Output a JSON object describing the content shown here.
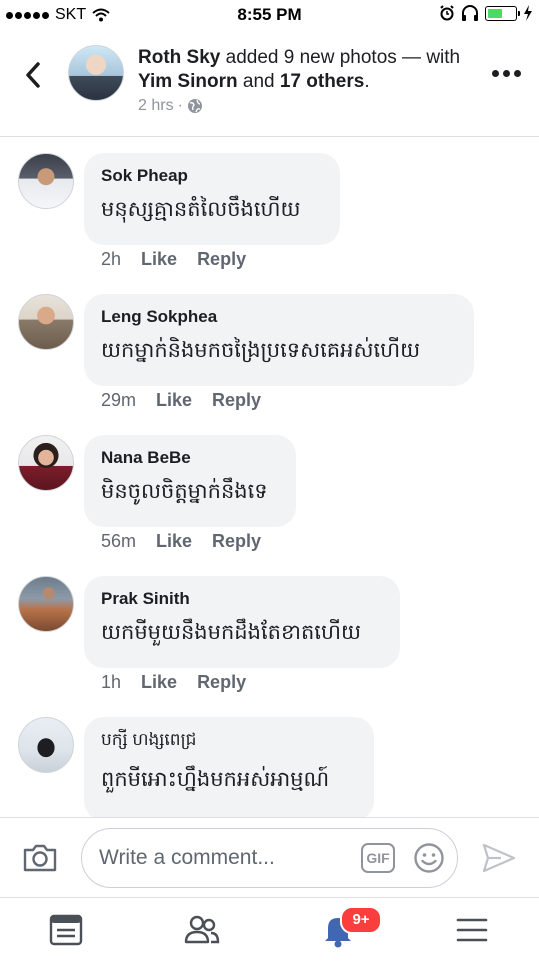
{
  "status_bar": {
    "carrier": "SKT",
    "time": "8:55 PM"
  },
  "post_header": {
    "author": "Roth Sky",
    "action": " added 9 new photos — with ",
    "tagged": "Yim Sinorn",
    "and_text": " and ",
    "others": "17 others",
    "period": ".",
    "time": "2 hrs",
    "separator": "·",
    "privacy_icon": "globe-icon"
  },
  "comments": [
    {
      "name": "Sok Pheap",
      "text": "មនុស្សគ្មានតំលៃចឹងហើយ",
      "time": "2h",
      "like": "Like",
      "reply": "Reply"
    },
    {
      "name": "Leng Sokphea",
      "text": "យកម្នាក់និងមកចង្រៃប្រទេសគេអស់ហើយ",
      "time": "29m",
      "like": "Like",
      "reply": "Reply"
    },
    {
      "name": "Nana BeBe",
      "text": "មិនចូលចិត្តម្នាក់នឹងទេ",
      "time": "56m",
      "like": "Like",
      "reply": "Reply"
    },
    {
      "name": "Prak Sinith",
      "text": "យកមីមួយនឹងមកដឹងតែខាតហើយ",
      "time": "1h",
      "like": "Like",
      "reply": "Reply"
    },
    {
      "name": "បក្សី ហង្សពេជ្រ",
      "text": "ពួកមីអោះហ្នឹងមកអស់អាម្មណ៍",
      "time": "",
      "like": "",
      "reply": ""
    }
  ],
  "composer": {
    "placeholder": "Write a comment...",
    "gif_label": "GIF"
  },
  "tabbar": {
    "notifications_badge": "9+"
  },
  "colors": {
    "accent": "#4267b2",
    "badge": "#fa3e3e",
    "bubble": "#f2f3f5",
    "battery": "#4cd964"
  }
}
